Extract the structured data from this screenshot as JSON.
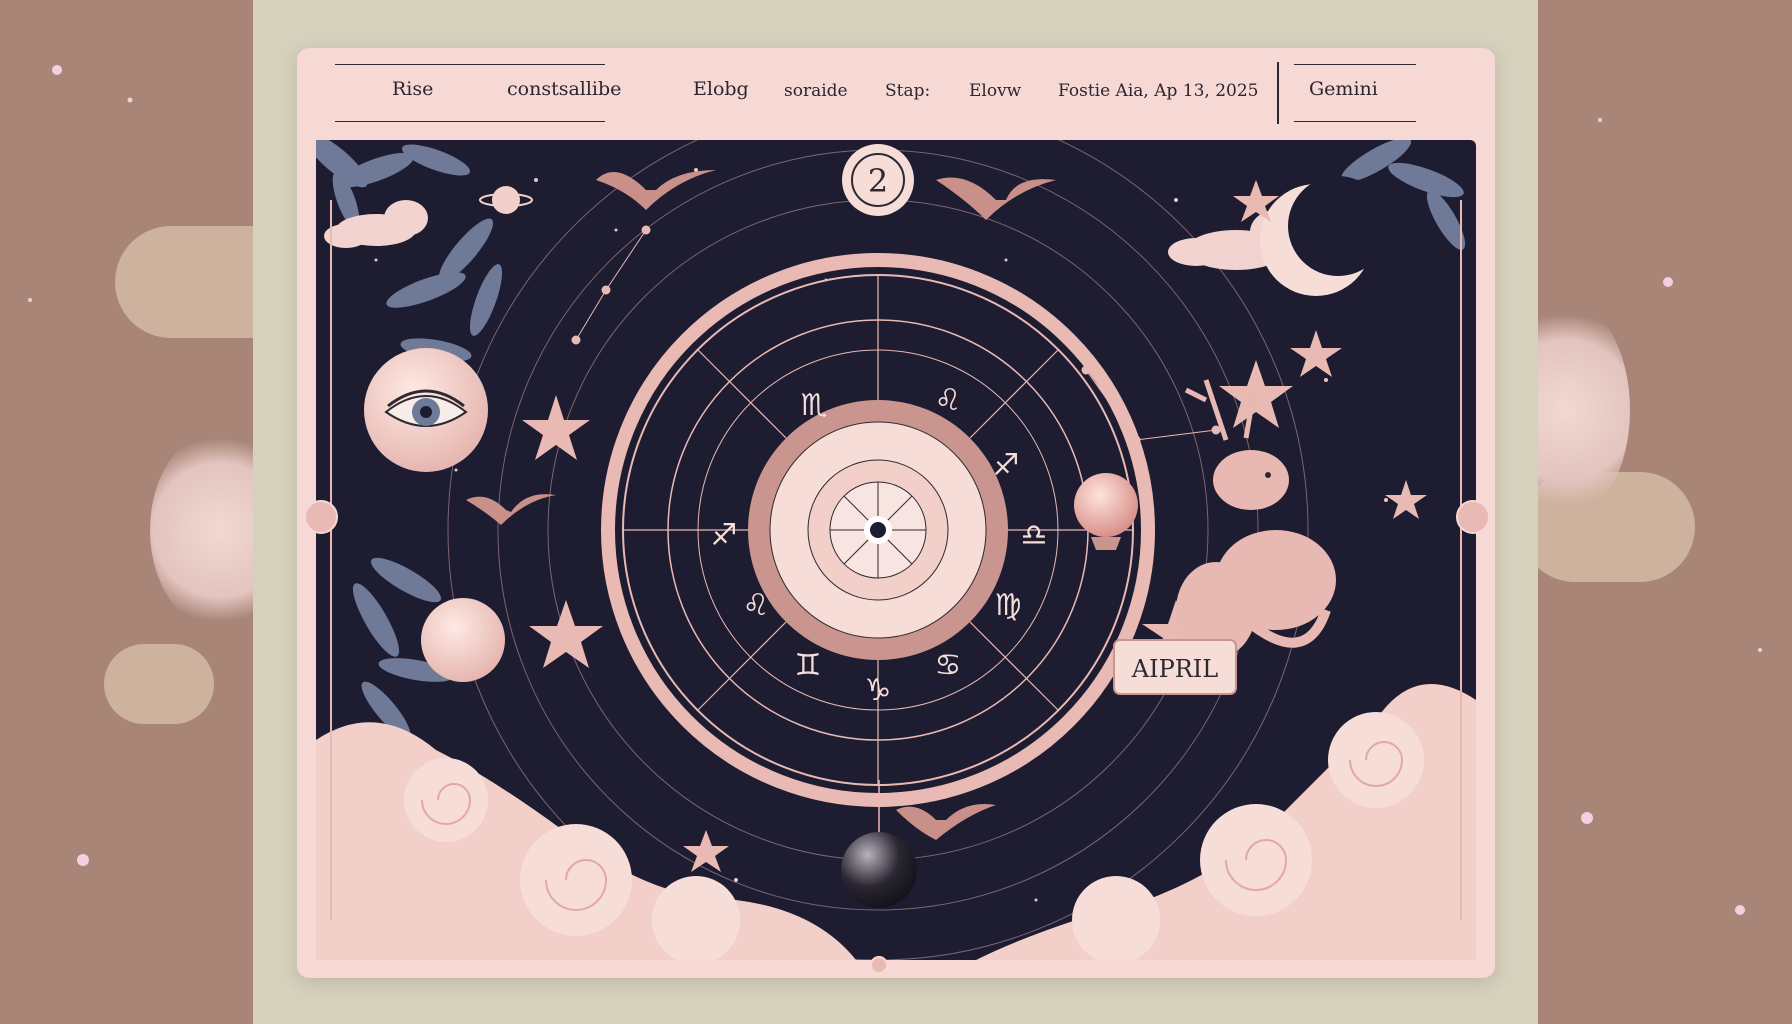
{
  "nav": {
    "items": [
      {
        "label": "Rise"
      },
      {
        "label": "constsallibe"
      },
      {
        "label": "Elobg"
      },
      {
        "label": "soraide"
      },
      {
        "label": "Stap:"
      },
      {
        "label": "Elovw"
      }
    ],
    "date": "Fostie Aia, Ap 13, 2025",
    "sign": "Gemini"
  },
  "chart": {
    "house_number": "2",
    "month_label": "AIPRIL",
    "glyphs": [
      "♏",
      "♌",
      "♐",
      "♐",
      "♎",
      "♌",
      "♍",
      "♊",
      "♋",
      "♑"
    ]
  },
  "colors": {
    "sky": "#1d1c30",
    "pink": "#e9b9b4",
    "cream": "#f6d8d5",
    "leaf": "#6f7a98",
    "frame": "#d5d1bd"
  }
}
